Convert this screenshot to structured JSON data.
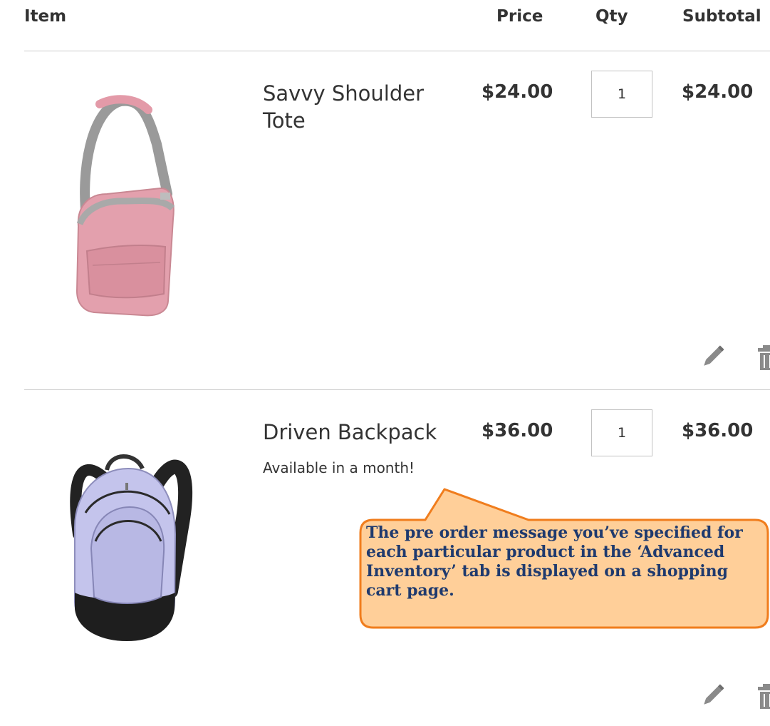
{
  "header": {
    "item": "Item",
    "price": "Price",
    "qty": "Qty",
    "subtotal": "Subtotal"
  },
  "items": [
    {
      "name": "Savvy Shoulder Tote",
      "price": "$24.00",
      "qty": "1",
      "subtotal": "$24.00",
      "edit_icon": "pencil-icon",
      "remove_icon": "trash-icon"
    },
    {
      "name": "Driven Backpack",
      "note": "Available in a month!",
      "price": "$36.00",
      "qty": "1",
      "subtotal": "$36.00",
      "edit_icon": "pencil-icon",
      "remove_icon": "trash-icon"
    }
  ],
  "callout": {
    "text": "The pre order message you’ve specified for each particular product in the ‘Advanced Inventory’ tab is displayed on a shopping cart page."
  },
  "colors": {
    "text": "#333333",
    "divider": "#cccccc",
    "callout_fill": "#ffcf99",
    "callout_border": "#f07d1d",
    "callout_text": "#1f3a6e",
    "tote": "#e3a0ad",
    "backpack": "#c4c4ec"
  }
}
